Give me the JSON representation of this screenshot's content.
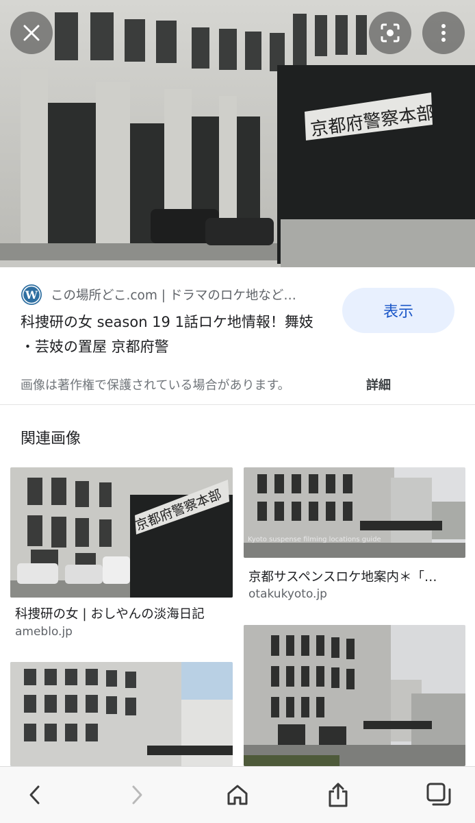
{
  "hero": {
    "sign_text": "京都府警察本部",
    "buttons": {
      "close": "close-icon",
      "lens": "lens-icon",
      "more": "more-vert-icon"
    }
  },
  "source": {
    "site_name": "この場所どこ.com | ドラマのロケ地など…",
    "site_icon": "wordpress-icon",
    "title": "科捜研の女 season 19 1話ロケ地情報！舞妓 ・芸妓の置屋 京都府警",
    "show_label": "表示",
    "copyright": "画像は著作権で保護されている場合があります。",
    "details_label": "詳細"
  },
  "related": {
    "heading": "関連画像",
    "cards": [
      {
        "title": "科捜研の女 | おしやんの淡海日記",
        "domain": "ameblo.jp",
        "sign_text": "京都府警察本部"
      },
      {
        "title": "京都サスペンスロケ地案内＊「…",
        "domain": "otakukyoto.jp",
        "overlay_text": "Kyoto suspense filming locations guide"
      },
      {
        "title": "",
        "domain": ""
      },
      {
        "title": "",
        "domain": ""
      }
    ]
  },
  "toolbar": {
    "icons": [
      "back-icon",
      "forward-icon",
      "home-icon",
      "share-icon",
      "tabs-icon"
    ]
  },
  "colors": {
    "accent": "#1a56c7",
    "button_bg": "#e8f0fe",
    "muted": "#70757a"
  }
}
